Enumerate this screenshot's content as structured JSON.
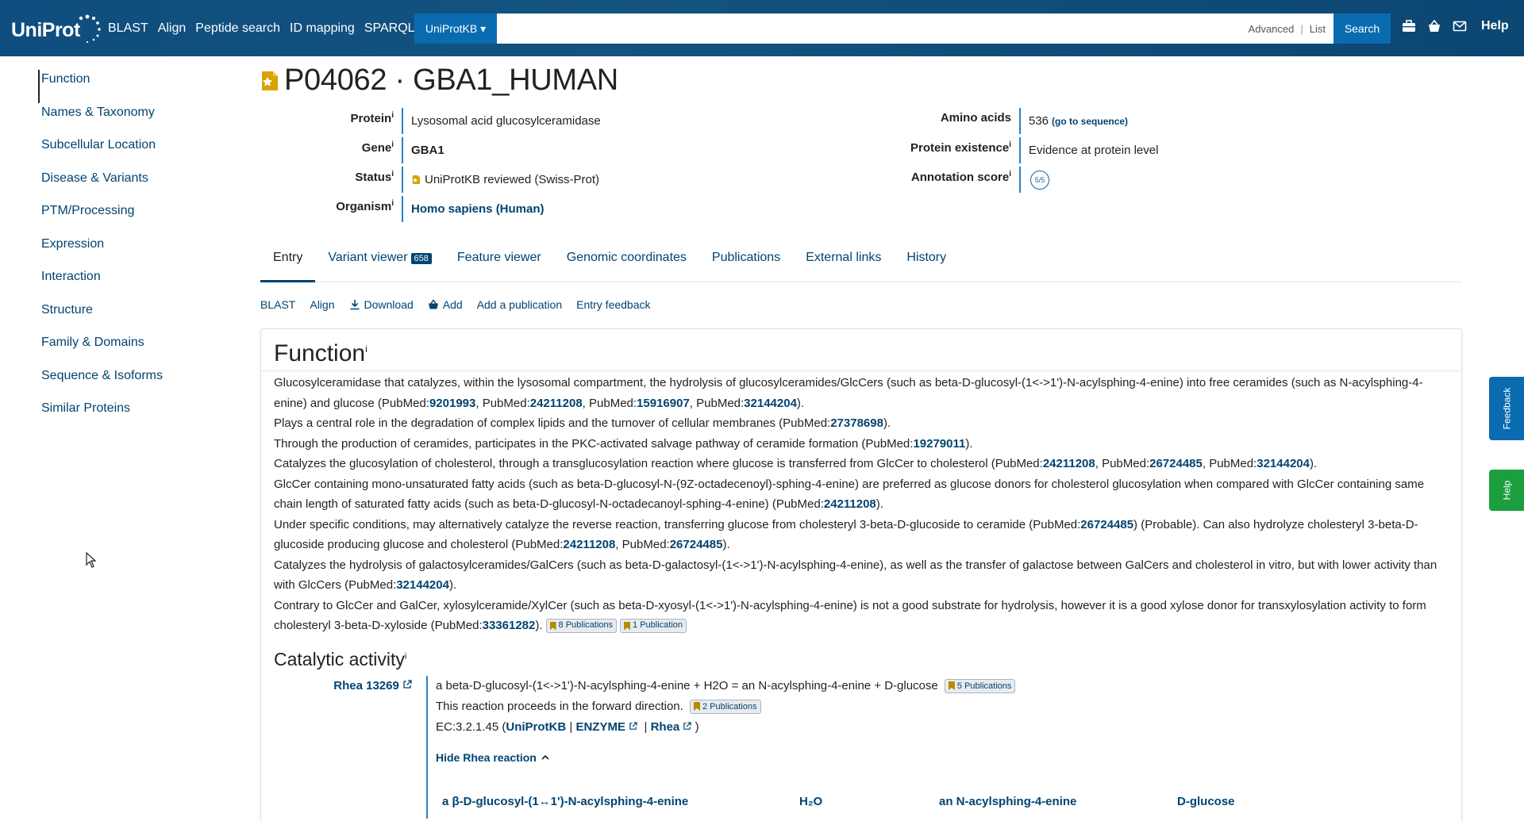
{
  "header": {
    "logo": "UniProt",
    "nav": [
      "BLAST",
      "Align",
      "Peptide search",
      "ID mapping",
      "SPARQL"
    ],
    "db_select": "UniProtKB ▾",
    "search_advanced": "Advanced",
    "search_list": "List",
    "search_button": "Search",
    "help": "Help"
  },
  "sidebar": {
    "items": [
      "Function",
      "Names & Taxonomy",
      "Subcellular Location",
      "Disease & Variants",
      "PTM/Processing",
      "Expression",
      "Interaction",
      "Structure",
      "Family & Domains",
      "Sequence & Isoforms",
      "Similar Proteins"
    ]
  },
  "entry": {
    "title": "P04062 · GBA1_HUMAN",
    "left": [
      {
        "label": "Protein",
        "value": "Lysosomal acid glucosylceramidase"
      },
      {
        "label": "Gene",
        "value": "GBA1"
      },
      {
        "label": "Status",
        "value": "UniProtKB reviewed (Swiss-Prot)"
      },
      {
        "label": "Organism",
        "value": "Homo sapiens (Human)"
      }
    ],
    "right": [
      {
        "label": "Amino acids",
        "value": "536",
        "extra": "(go to sequence)"
      },
      {
        "label": "Protein existence",
        "value": "Evidence at protein level"
      },
      {
        "label": "Annotation score",
        "value": "5/5"
      }
    ],
    "info_mark": "i"
  },
  "tabs": [
    {
      "label": "Entry"
    },
    {
      "label": "Variant viewer",
      "badge": "658"
    },
    {
      "label": "Feature viewer"
    },
    {
      "label": "Genomic coordinates"
    },
    {
      "label": "Publications"
    },
    {
      "label": "External links"
    },
    {
      "label": "History"
    }
  ],
  "toolbar": [
    "BLAST",
    "Align",
    "Download",
    "Add",
    "Add a publication",
    "Entry feedback"
  ],
  "function": {
    "heading": "Function",
    "paragraphs": [
      [
        {
          "t": "Glucosylceramidase that catalyzes, within the lysosomal compartment, the hydrolysis of glucosylceramides/GlcCers (such as beta-D-glucosyl-(1<->1')-N-acylsphing-4-enine) into free ceramides (such as N-acylsphing-4-enine) and glucose (PubMed:"
        },
        {
          "l": "9201993"
        },
        {
          "t": ", PubMed:"
        },
        {
          "l": "24211208"
        },
        {
          "t": ", PubMed:"
        },
        {
          "l": "15916907"
        },
        {
          "t": ", PubMed:"
        },
        {
          "l": "32144204"
        },
        {
          "t": ")."
        }
      ],
      [
        {
          "t": "Plays a central role in the degradation of complex lipids and the turnover of cellular membranes (PubMed:"
        },
        {
          "l": "27378698"
        },
        {
          "t": ")."
        }
      ],
      [
        {
          "t": "Through the production of ceramides, participates in the PKC-activated salvage pathway of ceramide formation (PubMed:"
        },
        {
          "l": "19279011"
        },
        {
          "t": ")."
        }
      ],
      [
        {
          "t": "Catalyzes the glucosylation of cholesterol, through a transglucosylation reaction where glucose is transferred from GlcCer to cholesterol (PubMed:"
        },
        {
          "l": "24211208"
        },
        {
          "t": ", PubMed:"
        },
        {
          "l": "26724485"
        },
        {
          "t": ", PubMed:"
        },
        {
          "l": "32144204"
        },
        {
          "t": ")."
        }
      ],
      [
        {
          "t": "GlcCer containing mono-unsaturated fatty acids (such as beta-D-glucosyl-N-(9Z-octadecenoyl)-sphing-4-enine) are preferred as glucose donors for cholesterol glucosylation when compared with GlcCer containing same chain length of saturated fatty acids (such as beta-D-glucosyl-N-octadecanoyl-sphing-4-enine) (PubMed:"
        },
        {
          "l": "24211208"
        },
        {
          "t": ")."
        }
      ],
      [
        {
          "t": "Under specific conditions, may alternatively catalyze the reverse reaction, transferring glucose from cholesteryl 3-beta-D-glucoside to ceramide (PubMed:"
        },
        {
          "l": "26724485"
        },
        {
          "t": ") (Probable). Can also hydrolyze cholesteryl 3-beta-D-glucoside producing glucose and cholesterol (PubMed:"
        },
        {
          "l": "24211208"
        },
        {
          "t": ", PubMed:"
        },
        {
          "l": "26724485"
        },
        {
          "t": ")."
        }
      ],
      [
        {
          "t": "Catalyzes the hydrolysis of galactosylceramides/GalCers (such as beta-D-galactosyl-(1<->1')-N-acylsphing-4-enine), as well as the transfer of galactose between GalCers and cholesterol in vitro, but with lower activity than with GlcCers (PubMed:"
        },
        {
          "l": "32144204"
        },
        {
          "t": ")."
        }
      ],
      [
        {
          "t": "Contrary to GlcCer and GalCer, xylosylceramide/XylCer (such as beta-D-xyosyl-(1<->1')-N-acylsphing-4-enine) is not a good substrate for hydrolysis, however it is a good xylose donor for transxylosylation activity to form cholesteryl 3-beta-D-xyloside (PubMed:"
        },
        {
          "l": "33361282"
        },
        {
          "t": ")."
        },
        {
          "b": "8 Publications"
        },
        {
          "b": "1 Publication"
        }
      ]
    ]
  },
  "catalytic": {
    "heading": "Catalytic activity",
    "rhea_id": "Rhea 13269",
    "reaction": "a beta-D-glucosyl-(1<->1')-N-acylsphing-4-enine + H2O = an N-acylsphing-4-enine + D-glucose",
    "reaction_pubs": "5 Publications",
    "direction": "This reaction proceeds in the forward direction.",
    "direction_pubs": "2 Publications",
    "ec_prefix": "EC:3.2.1.45 (",
    "ec_links": [
      "UniProtKB",
      "ENZYME",
      "Rhea"
    ],
    "ec_suffix": ")",
    "hide_rhea": "Hide Rhea reaction",
    "components": [
      "a β-D-glucosyl-(1↔1')-N-acylsphing-4-enine",
      "H₂O",
      "an N-acylsphing-4-enine",
      "D-glucose"
    ]
  },
  "side_tabs": {
    "feedback": "Feedback",
    "help": "Help"
  }
}
